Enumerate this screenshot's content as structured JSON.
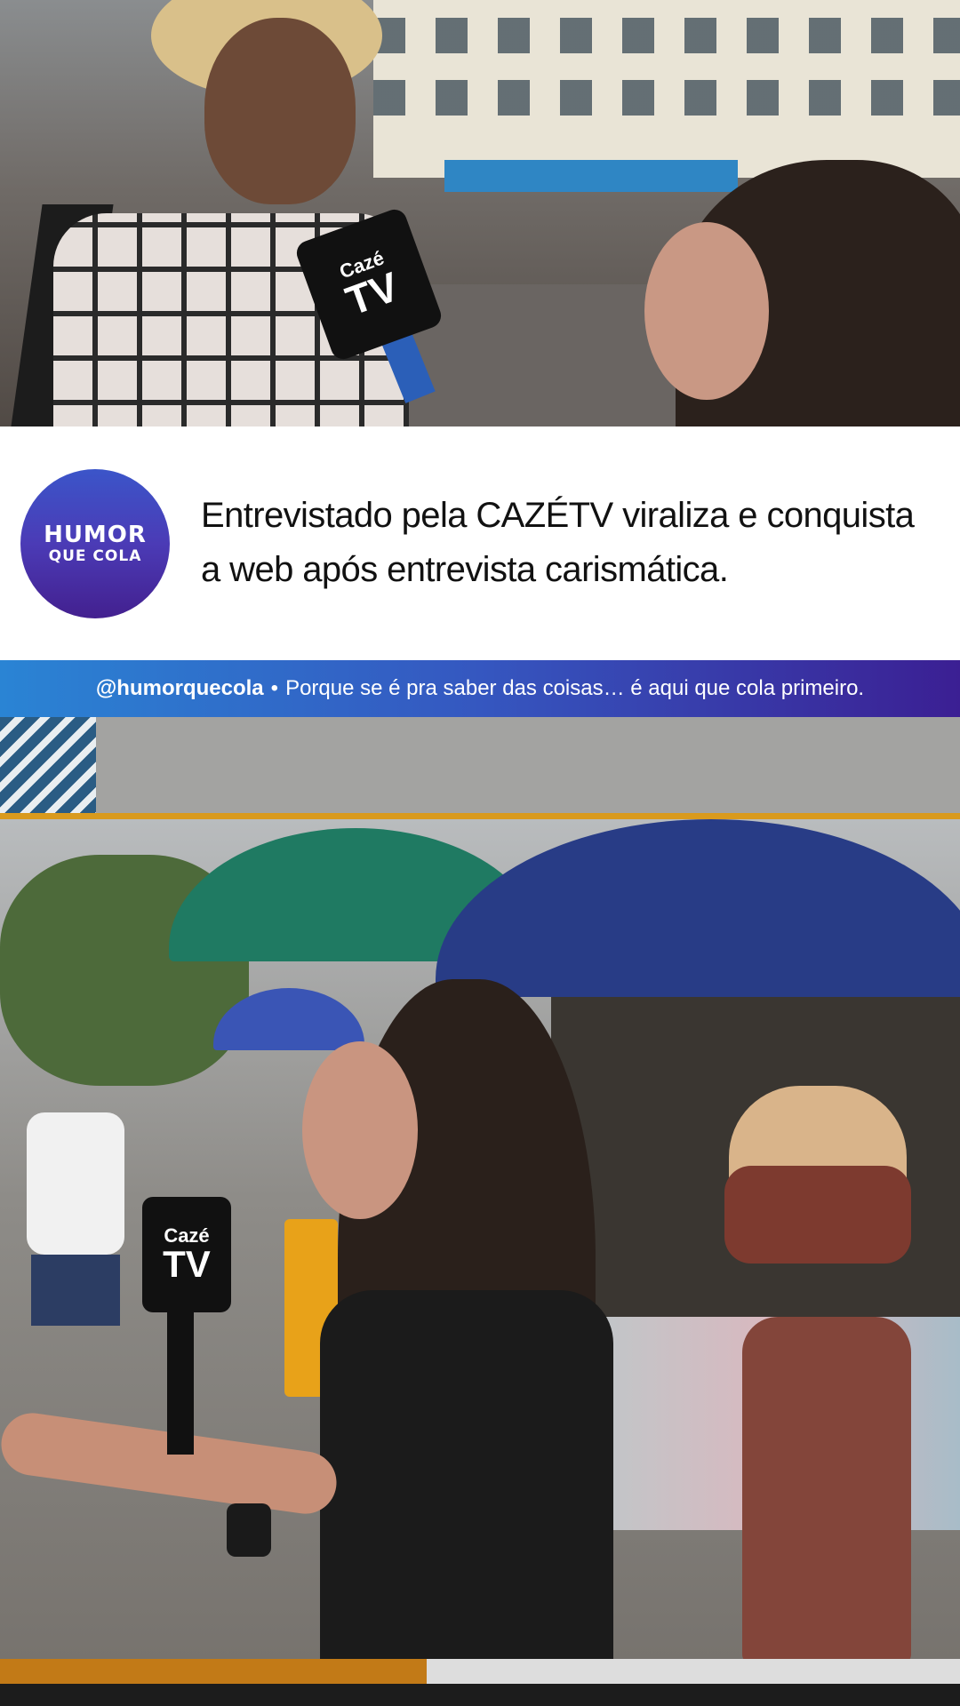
{
  "top_video": {
    "mic_brand_line1": "Cazé",
    "mic_brand_line2": "TV"
  },
  "logo": {
    "line1": "HUMOR",
    "line2": "QUE COLA"
  },
  "headline": {
    "text": "Entrevistado pela CAZÉTV viraliza e conquista a web após entrevista carismática."
  },
  "tagline": {
    "handle": "@humorquecola",
    "separator": "•",
    "text": "Porque se é pra saber das coisas… é aqui que cola primeiro."
  },
  "bottom_video": {
    "mic_brand_line1": "Cazé",
    "mic_brand_line2": "TV"
  },
  "colors": {
    "logo_gradient_top": "#3b55c9",
    "logo_gradient_bottom": "#43208f",
    "tag_bar_left": "#2a84d4",
    "tag_bar_right": "#3b1f93",
    "frame_accent": "#d99a1d"
  }
}
